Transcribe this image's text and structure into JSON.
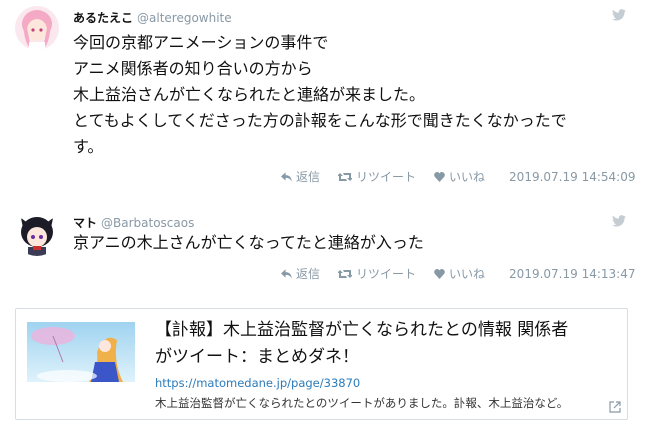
{
  "tweets": [
    {
      "display_name": "あるたえこ",
      "handle": "@alteregowhite",
      "lines": [
        "今回の京都アニメーションの事件で",
        "アニメ関係者の知り合いの方から",
        "木上益治さんが亡くなられたと連絡が来ました。",
        "とてもよくしてくださった方の訃報をこんな形で聞きたくなかったで",
        "す。"
      ],
      "reply_label": "返信",
      "retweet_label": "リツイート",
      "like_label": "いいね",
      "timestamp": "2019.07.19 14:54:09"
    },
    {
      "display_name": "マト",
      "handle": "@Barbatoscaos",
      "lines": [
        "京アニの木上さんが亡くなってたと連絡が入った"
      ],
      "reply_label": "返信",
      "retweet_label": "リツイート",
      "like_label": "いいね",
      "timestamp": "2019.07.19 14:13:47"
    }
  ],
  "card": {
    "title_line1": "【訃報】木上益治監督が亡くなられたとの情報 関係者",
    "title_line2": "がツイート：まとめダネ！",
    "url": "https://matomedane.jp/page/33870",
    "description": "木上益治監督が亡くなられたとのツイートがありました。訃報、木上益治など。"
  },
  "icons": {
    "bird": "twitter-bird-icon",
    "reply": "reply-icon",
    "retweet": "retweet-icon",
    "like": "heart-icon",
    "external": "external-link-icon"
  },
  "colors": {
    "muted": "#8899a6",
    "link": "#2b7bb9",
    "border": "#d8dde2"
  }
}
